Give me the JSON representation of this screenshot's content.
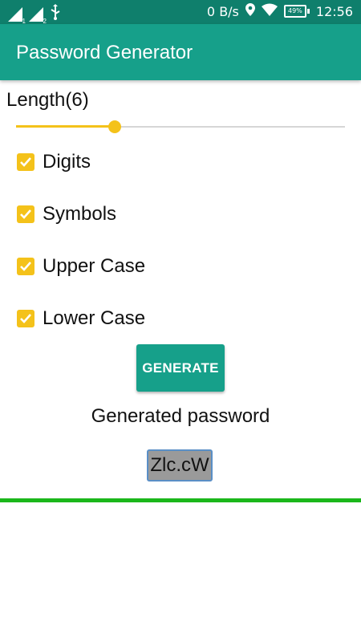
{
  "status_bar": {
    "sim1_label": "1",
    "sim2_label": "2",
    "network_speed": "0 B/s",
    "battery_percent": "49%",
    "time": "12:56",
    "icons": [
      "signal-icon",
      "signal-icon",
      "usb-icon",
      "location-icon",
      "wifi-icon",
      "battery-icon"
    ]
  },
  "app_bar": {
    "title": "Password Generator"
  },
  "length": {
    "label": "Length(6)",
    "slider_fraction": 0.3
  },
  "options": [
    {
      "label": "Digits",
      "checked": true
    },
    {
      "label": "Symbols",
      "checked": true
    },
    {
      "label": "Upper Case",
      "checked": true
    },
    {
      "label": "Lower Case",
      "checked": true
    }
  ],
  "generate_button": {
    "label": "GENERATE"
  },
  "result": {
    "caption": "Generated password",
    "password": "Zlc.cW"
  },
  "colors": {
    "status_bar": "#0f7f6c",
    "primary": "#16a08a",
    "accent": "#f4c21a",
    "divider": "#1bb71b"
  }
}
